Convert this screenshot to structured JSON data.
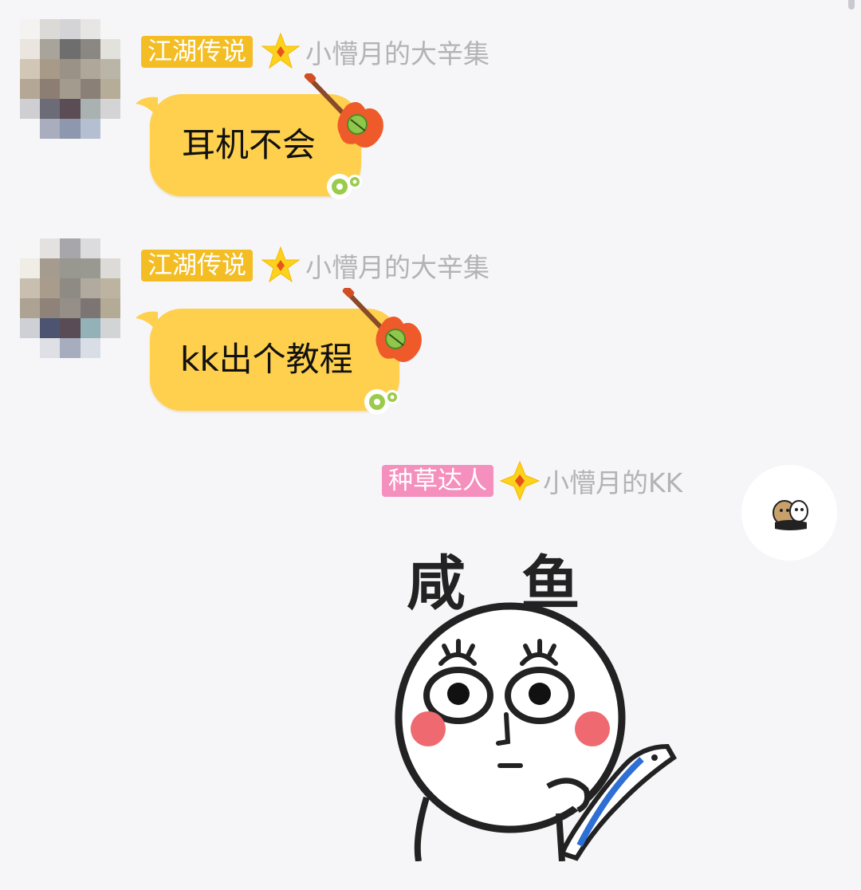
{
  "scrollbar_color": "#c9c9cf",
  "messages": [
    {
      "badge": "江湖传说",
      "badge_color": "#f3bd23",
      "sender": "小懵月的大辛集",
      "text": "耳机不会",
      "avatar_icon": "pixelated-avatar-icon",
      "decoration_icon": "guitar-icon"
    },
    {
      "badge": "江湖传说",
      "badge_color": "#f3bd23",
      "sender": "小懵月的大辛集",
      "text": "kk出个教程",
      "avatar_icon": "pixelated-avatar-icon",
      "decoration_icon": "guitar-icon"
    },
    {
      "badge": "种草达人",
      "badge_color": "#f58fbd",
      "sender": "小懵月的KK",
      "sticker_text": "咸  鱼",
      "avatar_icon": "cartoon-avatar-icon",
      "sticker_icon": "salted-fish-meme-sticker"
    }
  ],
  "colors": {
    "bubble": "#fed04e",
    "sender_text": "#b3b3b3",
    "background": "#f6f6f9"
  }
}
